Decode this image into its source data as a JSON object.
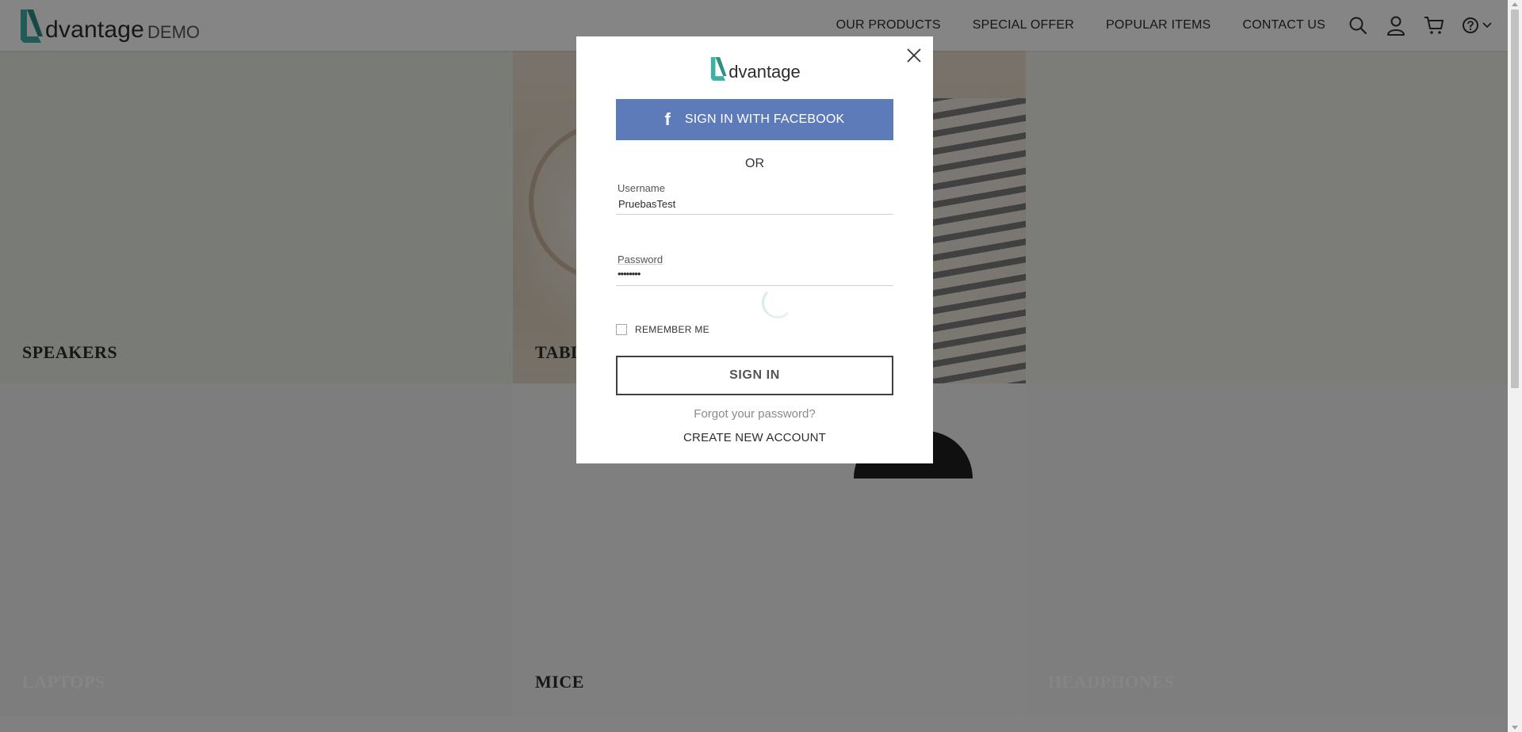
{
  "header": {
    "logo_text": "dvantage",
    "logo_suffix": "DEMO",
    "nav": [
      {
        "label": "OUR PRODUCTS"
      },
      {
        "label": "SPECIAL OFFER"
      },
      {
        "label": "POPULAR ITEMS"
      },
      {
        "label": "CONTACT US"
      }
    ],
    "icons": [
      "search-icon",
      "user-icon",
      "cart-icon",
      "help-icon",
      "chevron-down-icon"
    ]
  },
  "categories": {
    "speakers": "SPEAKERS",
    "tablets": "TABLETS",
    "laptops": "LAPTOPS",
    "mice": "MICE",
    "headphones": "HEADPHONES"
  },
  "login_modal": {
    "logo_text": "dvantage",
    "facebook_button": "SIGN IN WITH FACEBOOK",
    "or_text": "OR",
    "username": {
      "label": "Username",
      "value": "PruebasTest"
    },
    "password": {
      "label": "Password",
      "value": "••••••••"
    },
    "remember_me": "REMEMBER ME",
    "remember_checked": false,
    "sign_in_button": "SIGN IN",
    "forgot_password": "Forgot your password?",
    "create_account": "CREATE NEW ACCOUNT"
  },
  "colors": {
    "brand_teal": "#3eb1a4",
    "facebook_blue": "#5e7bb9",
    "overlay": "rgba(0,0,0,0.48)"
  }
}
